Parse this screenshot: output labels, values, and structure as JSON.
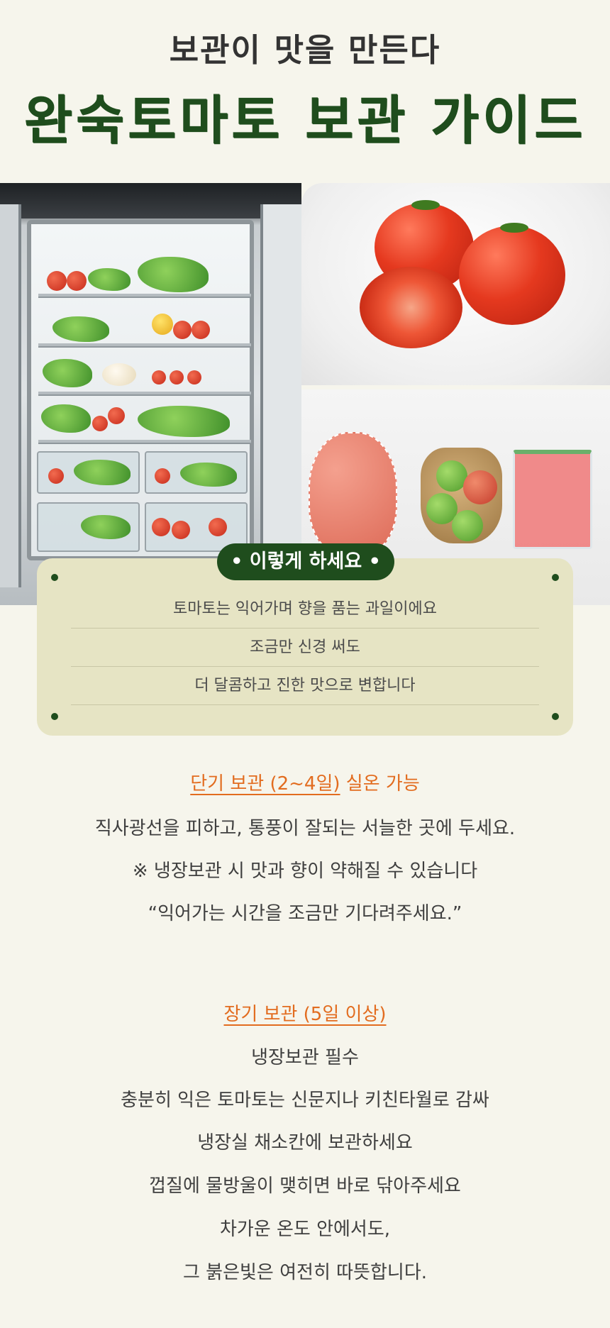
{
  "header": {
    "subtitle": "보관이 맛을 만든다",
    "title": "완숙토마토 보관 가이드"
  },
  "images": {
    "fridge": "refrigerator-with-vegetables",
    "tomatoes": "whole-and-halved-tomatoes",
    "bags": "tomatoes-in-net-bag-paper-bag-zip-bag"
  },
  "card": {
    "badge": "• 이렇게 하세요 •",
    "lines": [
      "토마토는 익어가며 향을 품는 과일이에요",
      "조금만 신경 써도",
      "더 달콤하고 진한 맛으로 변합니다"
    ]
  },
  "short_term": {
    "title_underlined": "단기 보관 (2~4일)",
    "title_rest": " 실온 가능",
    "lines": [
      "직사광선을 피하고, 통풍이 잘되는 서늘한 곳에 두세요.",
      "※ 냉장보관 시 맛과 향이 약해질 수 있습니다",
      "“익어가는 시간을 조금만 기다려주세요.”"
    ]
  },
  "long_term": {
    "title": "장기 보관 (5일 이상)",
    "lines": [
      "냉장보관 필수",
      "충분히 익은 토마토는 신문지나 키친타월로 감싸",
      "냉장실 채소칸에 보관하세요",
      "껍질에 물방울이 맺히면 바로 닦아주세요",
      "차가운 온도 안에서도,",
      "그 붉은빛은 여전히 따뜻합니다."
    ]
  },
  "colors": {
    "background": "#f6f5ec",
    "brand_green": "#1f4d1d",
    "accent_orange": "#e26c1f",
    "card_bg": "#e6e4c4"
  }
}
